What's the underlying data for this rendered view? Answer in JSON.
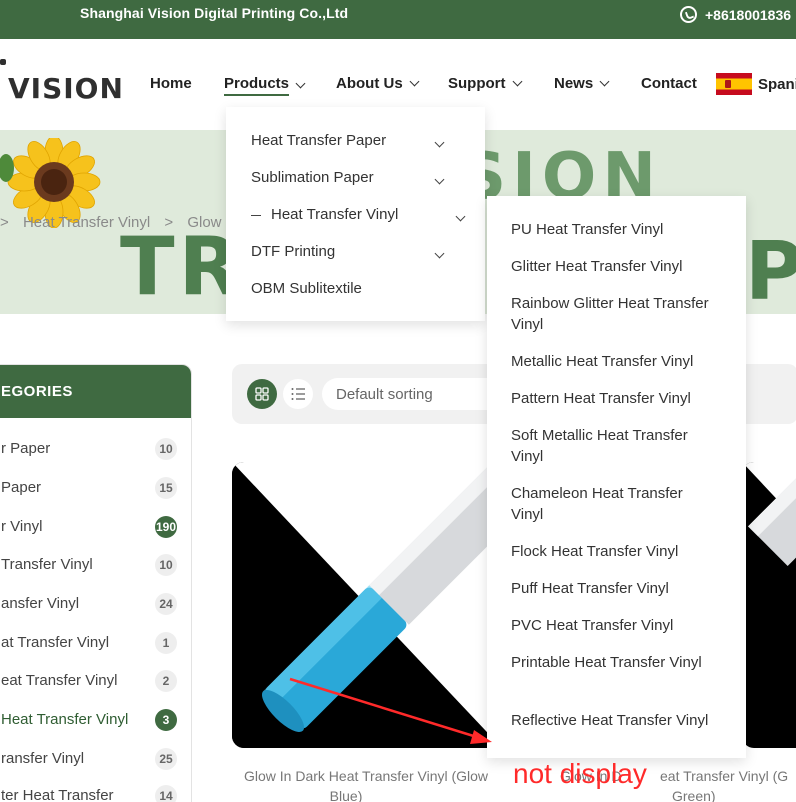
{
  "topbar": {
    "company": "Shanghai Vision Digital Printing Co.,Ltd",
    "phone": "+8618001836",
    "phone_icon": "whatsapp-icon"
  },
  "header": {
    "logo": "VISION",
    "nav": [
      {
        "label": "Home"
      },
      {
        "label": "Products"
      },
      {
        "label": "About Us"
      },
      {
        "label": "Support"
      },
      {
        "label": "News"
      },
      {
        "label": "Contact"
      }
    ],
    "language": "Spani"
  },
  "banner": {
    "text_top": "SION",
    "text_bottom": "TR",
    "text_right": "P",
    "breadcrumb": [
      ">",
      "Heat Transfer Vinyl",
      ">",
      "Glow In"
    ]
  },
  "products_menu": {
    "items": [
      {
        "label": "Heat Transfer Paper"
      },
      {
        "label": "Sublimation Paper"
      },
      {
        "label": "Heat Transfer Vinyl"
      },
      {
        "label": "DTF Printing"
      },
      {
        "label": "OBM Sublitextile"
      }
    ]
  },
  "vinyl_submenu": {
    "items": [
      {
        "label": "PU Heat Transfer Vinyl"
      },
      {
        "label": "Glitter Heat Transfer Vinyl"
      },
      {
        "label": "Rainbow Glitter Heat Transfer Vinyl"
      },
      {
        "label": "Metallic Heat Transfer Vinyl"
      },
      {
        "label": "Pattern Heat Transfer Vinyl"
      },
      {
        "label": "Soft Metallic Heat Transfer Vinyl"
      },
      {
        "label": "Chameleon Heat Transfer Vinyl"
      },
      {
        "label": "Flock Heat Transfer Vinyl"
      },
      {
        "label": "Puff Heat Transfer Vinyl"
      },
      {
        "label": "PVC Heat Transfer Vinyl"
      },
      {
        "label": "Printable Heat Transfer Vinyl"
      },
      {
        "label": "Reflective Heat Transfer Vinyl"
      }
    ]
  },
  "categories": {
    "title": "EGORIES",
    "items": [
      {
        "label": "r Paper",
        "count": "10"
      },
      {
        "label": "Paper",
        "count": "15"
      },
      {
        "label": "r Vinyl",
        "count": "190"
      },
      {
        "label": "Transfer Vinyl",
        "count": "10"
      },
      {
        "label": "ansfer Vinyl",
        "count": "24"
      },
      {
        "label": "at Transfer Vinyl",
        "count": "1"
      },
      {
        "label": "eat Transfer Vinyl",
        "count": "2"
      },
      {
        "label": "Heat Transfer Vinyl",
        "count": "3"
      },
      {
        "label": "ransfer Vinyl",
        "count": "25"
      },
      {
        "label": "ter Heat Transfer",
        "count": "14"
      }
    ]
  },
  "toolbar": {
    "grid_icon": "grid-view-icon",
    "list_icon": "list-view-icon",
    "sorting": "Default sorting"
  },
  "products": {
    "left_title_1": "Glow In Dark Heat Transfer Vinyl (Glow",
    "left_title_2": "Blue)",
    "right_title_1": "eat Transfer Vinyl (G",
    "right_title_2": "Green)",
    "middle_fragment": "Glow In D"
  },
  "annotation": {
    "text": "not display",
    "color": "#ff2a2a"
  },
  "colors": {
    "brand_green": "#3f6a41",
    "banner_bg": "#dfeadb"
  }
}
